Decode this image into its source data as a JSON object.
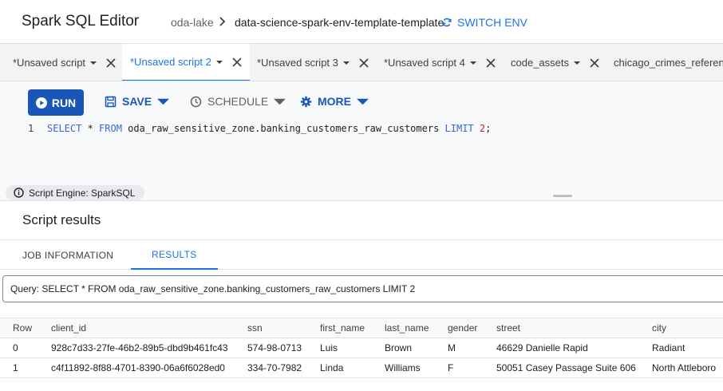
{
  "header": {
    "title": "Spark SQL Editor",
    "project": "oda-lake",
    "environment": "data-science-spark-env-template-template",
    "switch_env_label": "SWITCH ENV"
  },
  "tabs": [
    {
      "label": "*Unsaved script",
      "active": false
    },
    {
      "label": "*Unsaved script 2",
      "active": true
    },
    {
      "label": "*Unsaved script 3",
      "active": false
    },
    {
      "label": "*Unsaved script 4",
      "active": false
    },
    {
      "label": "code_assets",
      "active": false
    },
    {
      "label": "chicago_crimes_referen",
      "active": false
    }
  ],
  "toolbar": {
    "run_label": "RUN",
    "save_label": "SAVE",
    "schedule_label": "SCHEDULE",
    "more_label": "MORE"
  },
  "editor": {
    "line_number": "1",
    "code": {
      "kw1": "SELECT",
      "star": " * ",
      "kw2": "FROM",
      "table": " oda_raw_sensitive_zone.banking_customers_raw_customers ",
      "kw3": "LIMIT",
      "limit": "2",
      "end": ";"
    }
  },
  "engine": {
    "label": "Script Engine: SparkSQL"
  },
  "results": {
    "title": "Script results",
    "tabs": [
      "JOB INFORMATION",
      "RESULTS"
    ],
    "active_tab": "RESULTS",
    "query": "Query: SELECT * FROM oda_raw_sensitive_zone.banking_customers_raw_customers LIMIT 2",
    "columns": [
      "Row",
      "client_id",
      "ssn",
      "first_name",
      "last_name",
      "gender",
      "street",
      "city"
    ],
    "rows": [
      [
        "0",
        "928c7d33-27fe-46b2-89b5-dbd9b461fc43",
        "574-98-0713",
        "Luis",
        "Brown",
        "M",
        "46629 Danielle Rapid",
        "Radiant"
      ],
      [
        "1",
        "c4f11892-8f88-4701-8390-06a6f6028ed0",
        "334-70-7982",
        "Linda",
        "Williams",
        "F",
        "50051 Casey Passage Suite 606",
        "North Attleboro"
      ]
    ]
  },
  "colors": {
    "accent": "#1a73e8",
    "run_button": "#1a56b8"
  }
}
